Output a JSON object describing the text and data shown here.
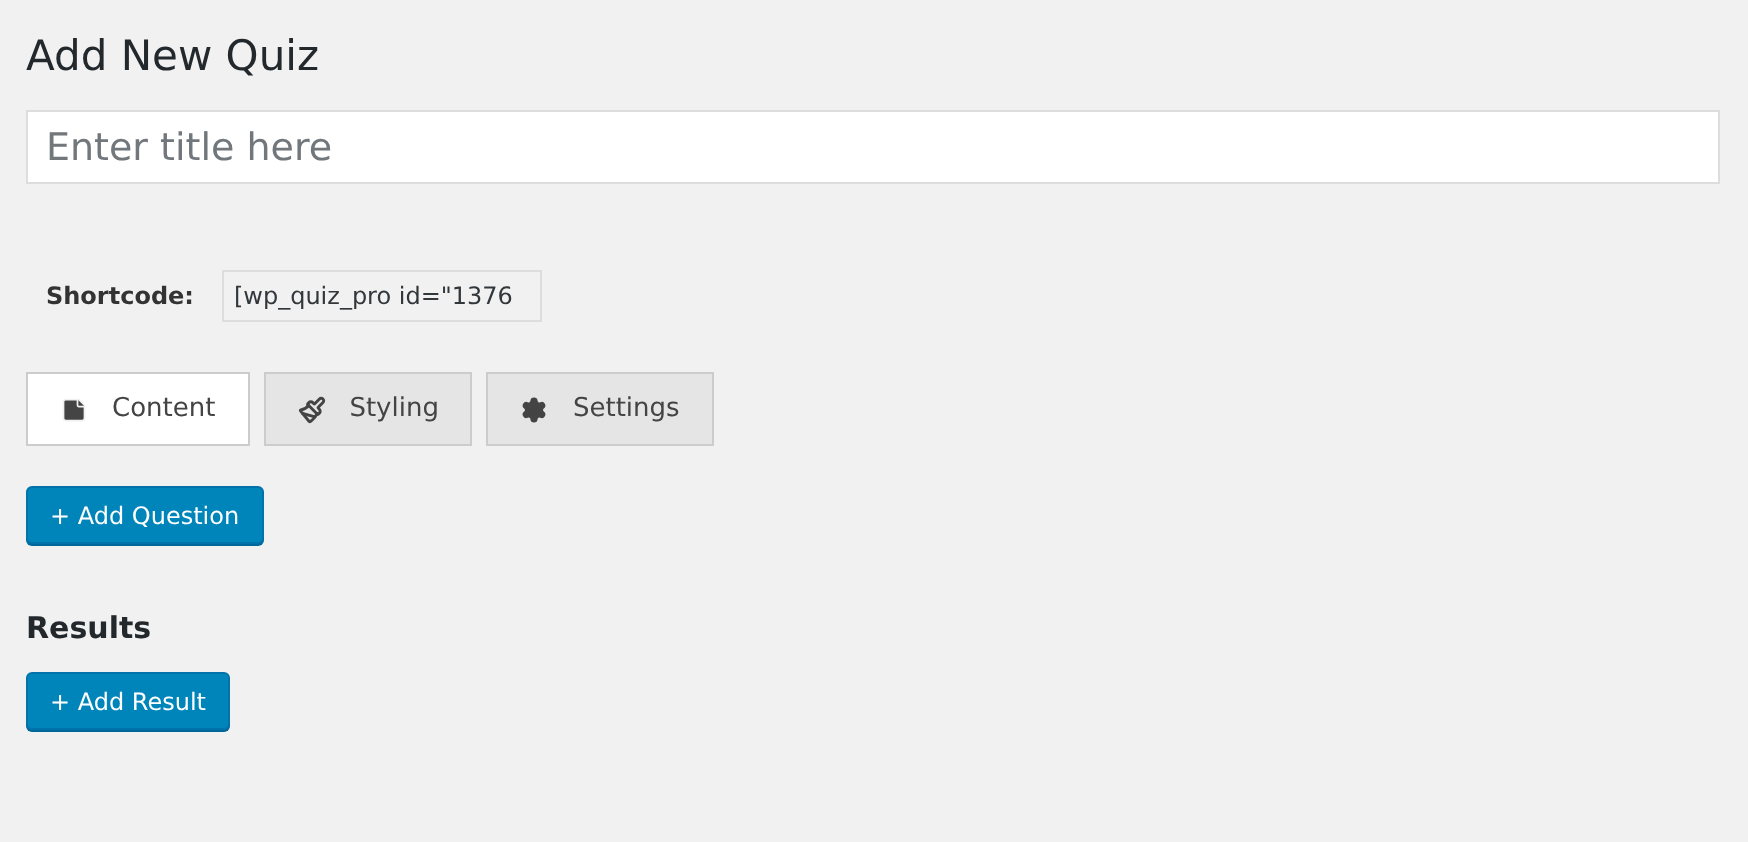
{
  "heading": "Add New Quiz",
  "title_field": {
    "placeholder": "Enter title here"
  },
  "shortcode": {
    "label": "Shortcode:",
    "value": "[wp_quiz_pro id=\"1376"
  },
  "tabs": [
    {
      "label": "Content",
      "kind": "content",
      "selected": true
    },
    {
      "label": "Styling",
      "kind": "styling",
      "selected": false
    },
    {
      "label": "Settings",
      "kind": "settings",
      "selected": false
    }
  ],
  "add_question_button": "+ Add Question",
  "results": {
    "heading": "Results",
    "add_result_button": "+ Add Result"
  }
}
